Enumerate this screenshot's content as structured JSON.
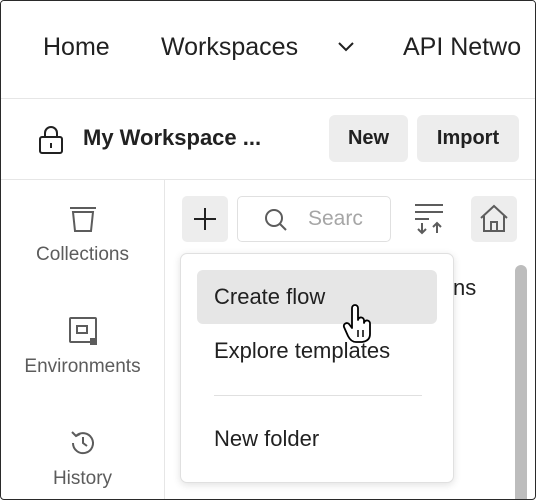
{
  "topnav": {
    "items": [
      {
        "label": "Home"
      },
      {
        "label": "Workspaces",
        "icon": "chevron-down-icon"
      },
      {
        "label": "API Netwo"
      }
    ]
  },
  "workspace": {
    "icon": "lock-icon",
    "title": "My Workspace ...",
    "new_label": "New",
    "import_label": "Import"
  },
  "rail": {
    "items": [
      {
        "label": "Collections",
        "icon": "collections-icon"
      },
      {
        "label": "Environments",
        "icon": "environments-icon"
      },
      {
        "label": "History",
        "icon": "history-icon"
      }
    ]
  },
  "sidebar": {
    "plus_icon": "plus-icon",
    "search": {
      "placeholder": "Searc",
      "icon": "search-icon"
    },
    "sort_icon": "sort-icon",
    "home_icon": "home-icon",
    "peek_text": "ns"
  },
  "menu": {
    "items": [
      {
        "label": "Create flow",
        "state": "hovered"
      },
      {
        "label": "Explore templates"
      },
      {
        "label": "New folder"
      }
    ]
  },
  "colors": {
    "button_bg": "#ededed",
    "hover_bg": "#e6e6e6",
    "text": "#212121",
    "muted": "#5c5c5c"
  }
}
